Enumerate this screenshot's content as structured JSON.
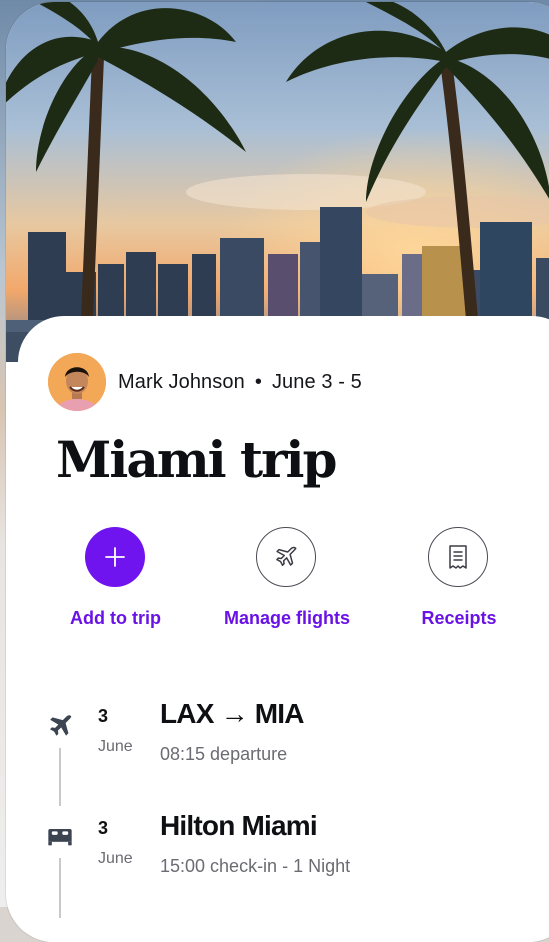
{
  "trip": {
    "owner_name": "Mark Johnson",
    "separator": "•",
    "dates": "June 3 - 5",
    "title": "Miami trip"
  },
  "actions": [
    {
      "label": "Add to trip",
      "icon": "plus-icon"
    },
    {
      "label": "Manage flights",
      "icon": "airplane-icon"
    },
    {
      "label": "Receipts",
      "icon": "receipt-icon"
    }
  ],
  "timeline": [
    {
      "day": "3",
      "month": "June",
      "title": "LAX → MIA",
      "subtitle": "08:15 departure",
      "icon": "airplane-icon"
    },
    {
      "day": "3",
      "month": "June",
      "title": "Hilton Miami",
      "subtitle": "15:00 check-in - 1 Night",
      "icon": "bed-icon"
    }
  ],
  "colors": {
    "accent": "#6f14ef",
    "accent_text": "#6a12e6",
    "title": "#0e0f12",
    "muted": "#6b6b73"
  }
}
